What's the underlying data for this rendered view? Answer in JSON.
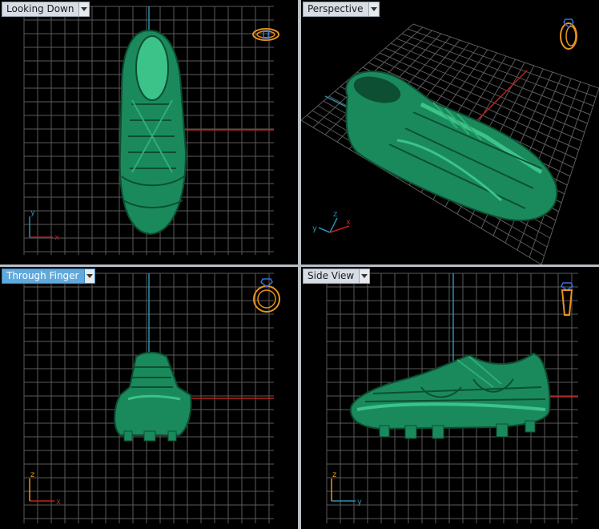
{
  "viewports": {
    "top": {
      "label": "Looking Down",
      "active": false
    },
    "perspective": {
      "label": "Perspective",
      "active": false
    },
    "front": {
      "label": "Through Finger",
      "active": true
    },
    "side": {
      "label": "Side View",
      "active": false
    }
  },
  "colors": {
    "shoe": "#1a8a5c",
    "shoe_light": "#3cc38a",
    "shoe_dark": "#0c4f33",
    "grid": "#5a5a5a",
    "axis_red": "#c0201e",
    "axis_blue": "#2a8fb0",
    "ring": "#e8921e",
    "gem": "#3a6fd0",
    "tab_active": "#5fa9dc",
    "tab_bg": "#d7dde4"
  },
  "icons": {
    "tab_dropdown": "chevron-down-icon",
    "view_indicator": "ring-icon"
  }
}
